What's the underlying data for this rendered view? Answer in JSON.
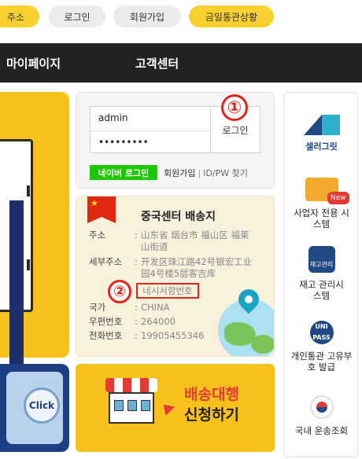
{
  "top_links": {
    "address": "주소",
    "login": "로그인",
    "signup": "회원가입",
    "status": "금일통관상황"
  },
  "nav": {
    "mypage": "마이페이지",
    "support": "고객센터"
  },
  "login": {
    "username": "admin",
    "password_mask": "•••••••••",
    "login_button": "로그인",
    "naver_login": "네이버 로그인",
    "signup_link": "회원가입",
    "separator": "|",
    "find_link": "ID/PW 찾기"
  },
  "annotations": {
    "one": "①",
    "two": "②"
  },
  "address_card": {
    "title": "중국센터 배송지",
    "address_label": "주소",
    "address_value": "山东省 烟台市 福山区 福莱山街道",
    "detail_label": "세부주소",
    "detail_value": "开发区珠江路42号银宏工业园4号楼5层客吉库",
    "secret_code": "네시서함번호",
    "country_label": "국가",
    "country_value": "CHINA",
    "zip_label": "우편번호",
    "zip_value": "264000",
    "phone_label": "전화번호",
    "phone_value": "19905455346",
    "colon": ":"
  },
  "delivery_banner": {
    "title": "배송대행",
    "subtitle": "신청하기"
  },
  "left_banner": {
    "click_label": "Click"
  },
  "sidebar": {
    "seller_logo": "셀러그릿",
    "business": "사업자 전용 시스템",
    "new_badge": "New",
    "inventory_icon_text": "재고관리",
    "inventory": "재고 관리시스템",
    "unipass_icon_text": "UNI PASS",
    "customs": "개인통관 고유부호 발급",
    "domestic": "국내 운송조회"
  }
}
